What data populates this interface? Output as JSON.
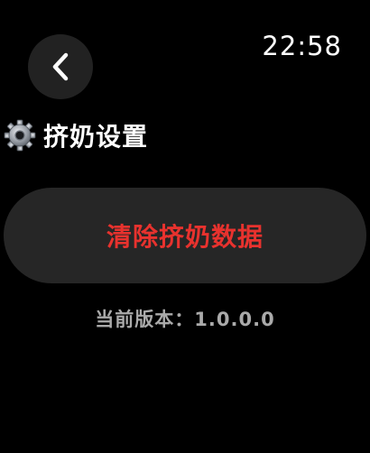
{
  "status_bar": {
    "time": "22:58"
  },
  "header": {
    "back_icon": "chevron-left-icon",
    "title_icon": "gear-icon",
    "title": "挤奶设置"
  },
  "actions": {
    "clear_data_label": "清除挤奶数据"
  },
  "footer": {
    "version_label": "当前版本：",
    "version_value": "1.0.0.0"
  },
  "colors": {
    "background": "#000000",
    "button_bg": "#262626",
    "back_bg": "#222222",
    "danger": "#e8322e",
    "muted_text": "#aaaaaa"
  }
}
